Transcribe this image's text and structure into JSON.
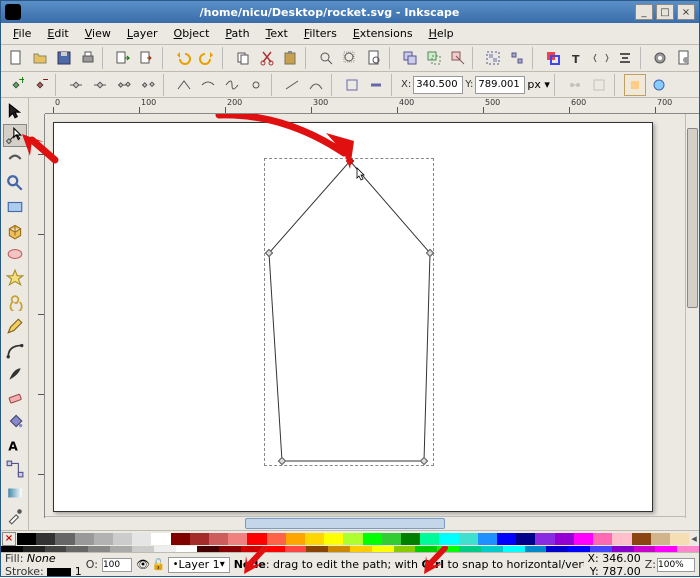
{
  "window": {
    "title": "/home/nicu/Desktop/rocket.svg - Inkscape"
  },
  "menus": [
    "File",
    "Edit",
    "View",
    "Layer",
    "Object",
    "Path",
    "Text",
    "Filters",
    "Extensions",
    "Help"
  ],
  "coords": {
    "x_label": "X:",
    "y_label": "Y:",
    "x_value": "340.500",
    "y_value": "789.001",
    "unit": "px"
  },
  "ruler_h_ticks": [
    0,
    100,
    200,
    300,
    400,
    500,
    600,
    700
  ],
  "status": {
    "fill_label": "Fill:",
    "fill_value": "None",
    "stroke_label": "Stroke:",
    "stroke_swatch": "#000000",
    "stroke_width": "1",
    "opacity_label": "O:",
    "opacity_value": "100",
    "layer_label": "Layer 1",
    "hint_prefix": "Node",
    "hint_body": ": drag to edit the path; with ",
    "hint_mod": "Ctrl",
    "hint_tail": " to snap to horizontal/vert.",
    "cursor_x_label": "X:",
    "cursor_x_value": "346.00",
    "cursor_y_label": "Y:",
    "cursor_y_value": "787.00",
    "zoom_label": "Z:",
    "zoom_value": "100%"
  },
  "colors": {
    "spectrum": [
      "#000",
      "#222",
      "#444",
      "#666",
      "#888",
      "#aaa",
      "#ccc",
      "#eee",
      "#fff",
      "#400",
      "#800",
      "#c00",
      "#f00",
      "#f44",
      "#840",
      "#c80",
      "#fc0",
      "#ff0",
      "#8c0",
      "#0c0",
      "#0f0",
      "#0c8",
      "#0cc",
      "#0ff",
      "#08c",
      "#00c",
      "#00f",
      "#44f",
      "#80c",
      "#c0c",
      "#f0f",
      "#f8c"
    ],
    "palette": [
      "#000000",
      "#333333",
      "#666666",
      "#999999",
      "#b2b2b2",
      "#cccccc",
      "#e5e5e5",
      "#ffffff",
      "#800000",
      "#a52a2a",
      "#cd5c5c",
      "#f08080",
      "#ff0000",
      "#ff6347",
      "#ffa500",
      "#ffd700",
      "#ffff00",
      "#adff2f",
      "#00ff00",
      "#32cd32",
      "#008000",
      "#00fa9a",
      "#00ffff",
      "#40e0d0",
      "#1e90ff",
      "#0000ff",
      "#00008b",
      "#8a2be2",
      "#9400d3",
      "#ff00ff",
      "#ff69b4",
      "#ffc0cb",
      "#8b4513",
      "#d2b48c",
      "#f5deb3"
    ]
  },
  "icons": {
    "selector": "selector-tool",
    "node": "node-tool"
  }
}
